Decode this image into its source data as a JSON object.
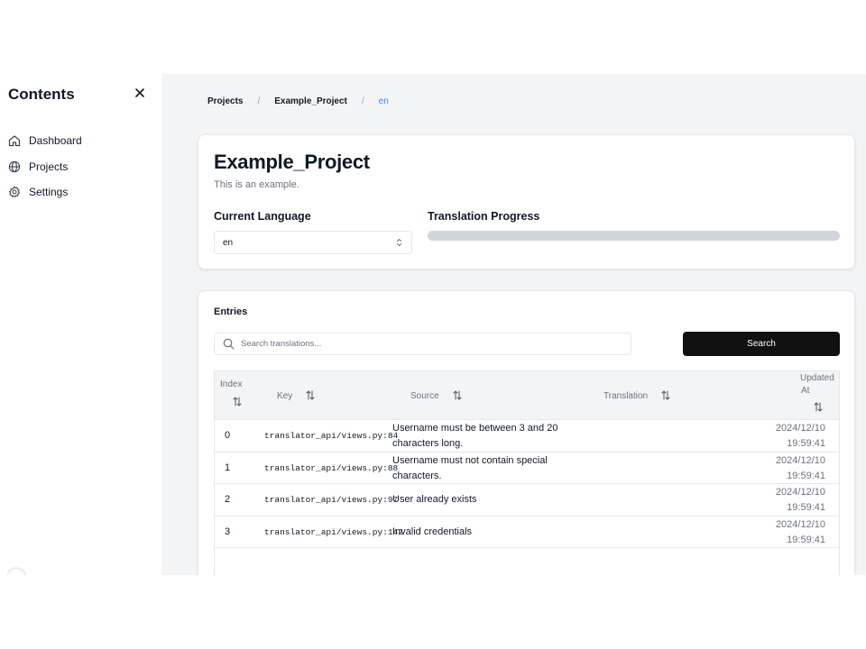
{
  "sidebar": {
    "title": "Contents",
    "items": [
      {
        "label": "Dashboard",
        "icon": "home-icon"
      },
      {
        "label": "Projects",
        "icon": "globe-icon"
      },
      {
        "label": "Settings",
        "icon": "gear-icon"
      }
    ]
  },
  "breadcrumb": {
    "items": [
      "Projects",
      "Example_Project"
    ],
    "separator": "/",
    "current": "en"
  },
  "project": {
    "title": "Example_Project",
    "description": "This is an example.",
    "language_label": "Current Language",
    "language_value": "en",
    "progress_label": "Translation Progress",
    "progress_value": 0
  },
  "entries": {
    "title": "Entries",
    "search_placeholder": "Search translations...",
    "search_button": "Search",
    "columns": {
      "index": "Index",
      "key": "Key",
      "source": "Source",
      "translation": "Translation",
      "updated_line1": "Updated",
      "updated_line2": "At"
    },
    "rows": [
      {
        "index": "0",
        "key": "translator_api/views.py:84",
        "source": "Username must be between 3 and 20 characters long.",
        "translation": "",
        "updated_date": "2024/12/10",
        "updated_time": "19:59:41"
      },
      {
        "index": "1",
        "key": "translator_api/views.py:88",
        "source": "Username must not contain special characters.",
        "translation": "",
        "updated_date": "2024/12/10",
        "updated_time": "19:59:41"
      },
      {
        "index": "2",
        "key": "translator_api/views.py:97",
        "source": "User already exists",
        "translation": "",
        "updated_date": "2024/12/10",
        "updated_time": "19:59:41"
      },
      {
        "index": "3",
        "key": "translator_api/views.py:142",
        "source": "Invalid credentials",
        "translation": "",
        "updated_date": "2024/12/10",
        "updated_time": "19:59:41"
      }
    ]
  },
  "colors": {
    "accent": "#3b82f6",
    "button_bg": "#111111",
    "main_bg": "#f3f4f6"
  }
}
